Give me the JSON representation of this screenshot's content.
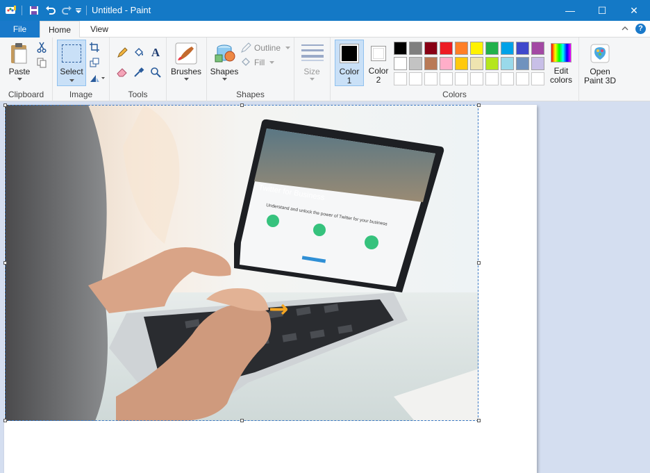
{
  "titlebar": {
    "title": "Untitled - Paint",
    "controls": {
      "minimize": "—",
      "maximize": "☐",
      "close": "✕"
    }
  },
  "tabs": {
    "file": "File",
    "home": "Home",
    "view": "View"
  },
  "ribbon": {
    "clipboard": {
      "paste": "Paste",
      "group": "Clipboard"
    },
    "image": {
      "select": "Select",
      "group": "Image"
    },
    "tools": {
      "group": "Tools",
      "text_icon": "A"
    },
    "brushes": {
      "label": "Brushes"
    },
    "shapes": {
      "shapes": "Shapes",
      "outline": "Outline",
      "fill": "Fill",
      "group": "Shapes"
    },
    "size": {
      "label": "Size"
    },
    "colors": {
      "color1_line1": "Color",
      "color1_line2": "1",
      "color2_line1": "Color",
      "color2_line2": "2",
      "edit_line1": "Edit",
      "edit_line2": "colors",
      "group": "Colors",
      "color1_value": "#000000",
      "color2_value": "#ffffff",
      "palette_row1": [
        "#000000",
        "#7f7f7f",
        "#880015",
        "#ed1c24",
        "#ff7f27",
        "#fff200",
        "#22b14c",
        "#00a2e8",
        "#3f48cc",
        "#a349a4"
      ],
      "palette_row2": [
        "#ffffff",
        "#c3c3c3",
        "#b97a57",
        "#ffaec9",
        "#ffc90e",
        "#efe4b0",
        "#b5e61d",
        "#99d9ea",
        "#7092be",
        "#c8bfe7"
      ],
      "palette_row3": [
        "",
        "",
        "",
        "",
        "",
        "",
        "",
        "",
        "",
        ""
      ]
    },
    "paint3d": {
      "line1": "Open",
      "line2": "Paint 3D"
    }
  },
  "photo": {
    "screen_heading": "Twitter for Business",
    "screen_subheading": "Understand and unlock the power of Twitter for your business",
    "arrow": "→"
  }
}
